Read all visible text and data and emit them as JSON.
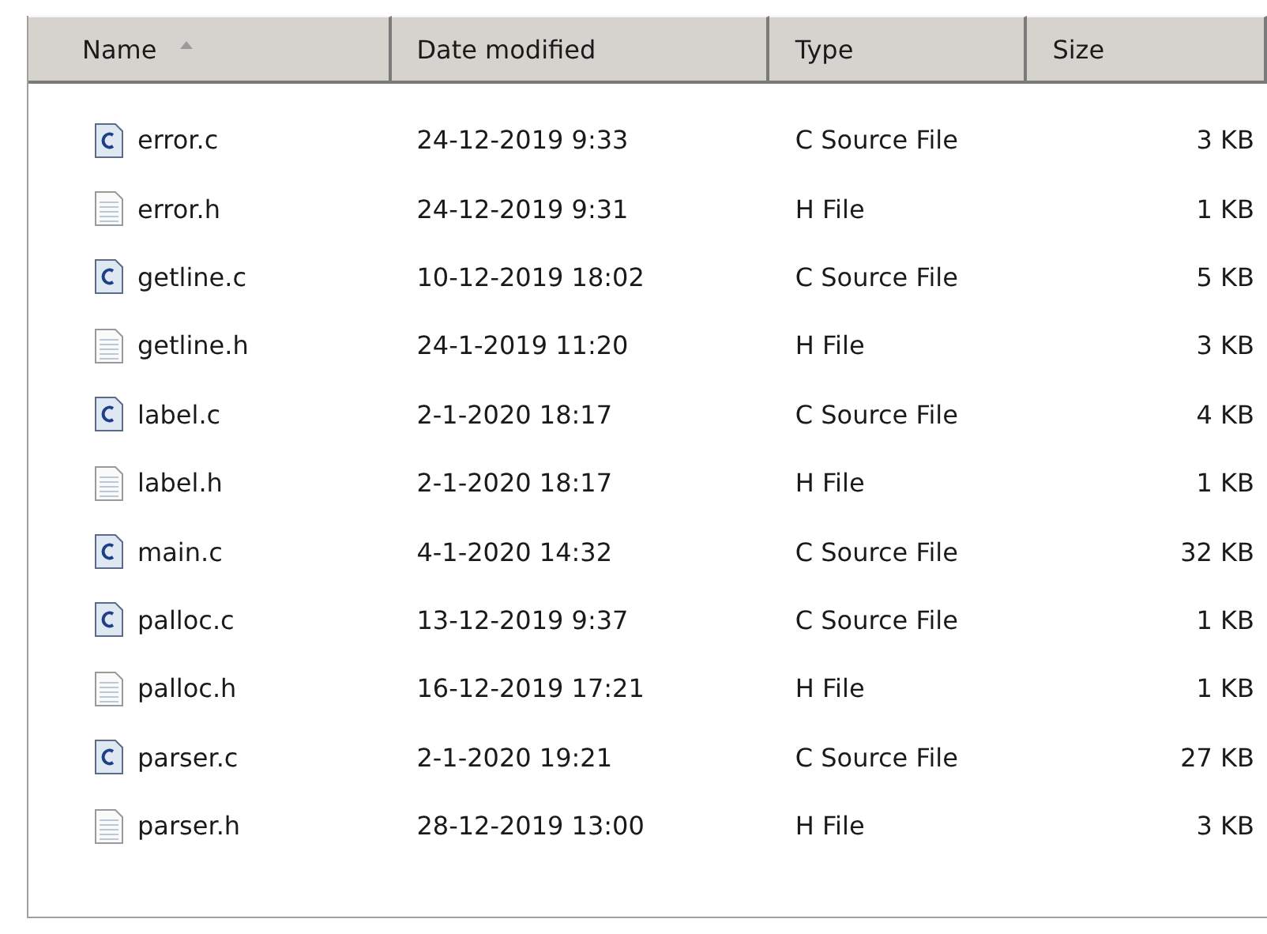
{
  "table": {
    "columns": [
      {
        "label": "Name",
        "sorted": true
      },
      {
        "label": "Date modified",
        "sorted": false
      },
      {
        "label": "Type",
        "sorted": false
      },
      {
        "label": "Size",
        "sorted": false
      }
    ],
    "rows": [
      {
        "kind": "c-source",
        "name": "error.c",
        "date": "24-12-2019 9:33",
        "type": "C Source File",
        "size": "3 KB"
      },
      {
        "kind": "header",
        "name": "error.h",
        "date": "24-12-2019 9:31",
        "type": "H File",
        "size": "1 KB"
      },
      {
        "kind": "c-source",
        "name": "getline.c",
        "date": "10-12-2019 18:02",
        "type": "C Source File",
        "size": "5 KB"
      },
      {
        "kind": "header",
        "name": "getline.h",
        "date": "24-1-2019 11:20",
        "type": "H File",
        "size": "3 KB"
      },
      {
        "kind": "c-source",
        "name": "label.c",
        "date": "2-1-2020 18:17",
        "type": "C Source File",
        "size": "4 KB"
      },
      {
        "kind": "header",
        "name": "label.h",
        "date": "2-1-2020 18:17",
        "type": "H File",
        "size": "1 KB"
      },
      {
        "kind": "c-source",
        "name": "main.c",
        "date": "4-1-2020 14:32",
        "type": "C Source File",
        "size": "32 KB"
      },
      {
        "kind": "c-source",
        "name": "palloc.c",
        "date": "13-12-2019 9:37",
        "type": "C Source File",
        "size": "1 KB"
      },
      {
        "kind": "header",
        "name": "palloc.h",
        "date": "16-12-2019 17:21",
        "type": "H File",
        "size": "1 KB"
      },
      {
        "kind": "c-source",
        "name": "parser.c",
        "date": "2-1-2020 19:21",
        "type": "C Source File",
        "size": "27 KB"
      },
      {
        "kind": "header",
        "name": "parser.h",
        "date": "28-12-2019 13:00",
        "type": "H File",
        "size": "3 KB"
      }
    ]
  }
}
